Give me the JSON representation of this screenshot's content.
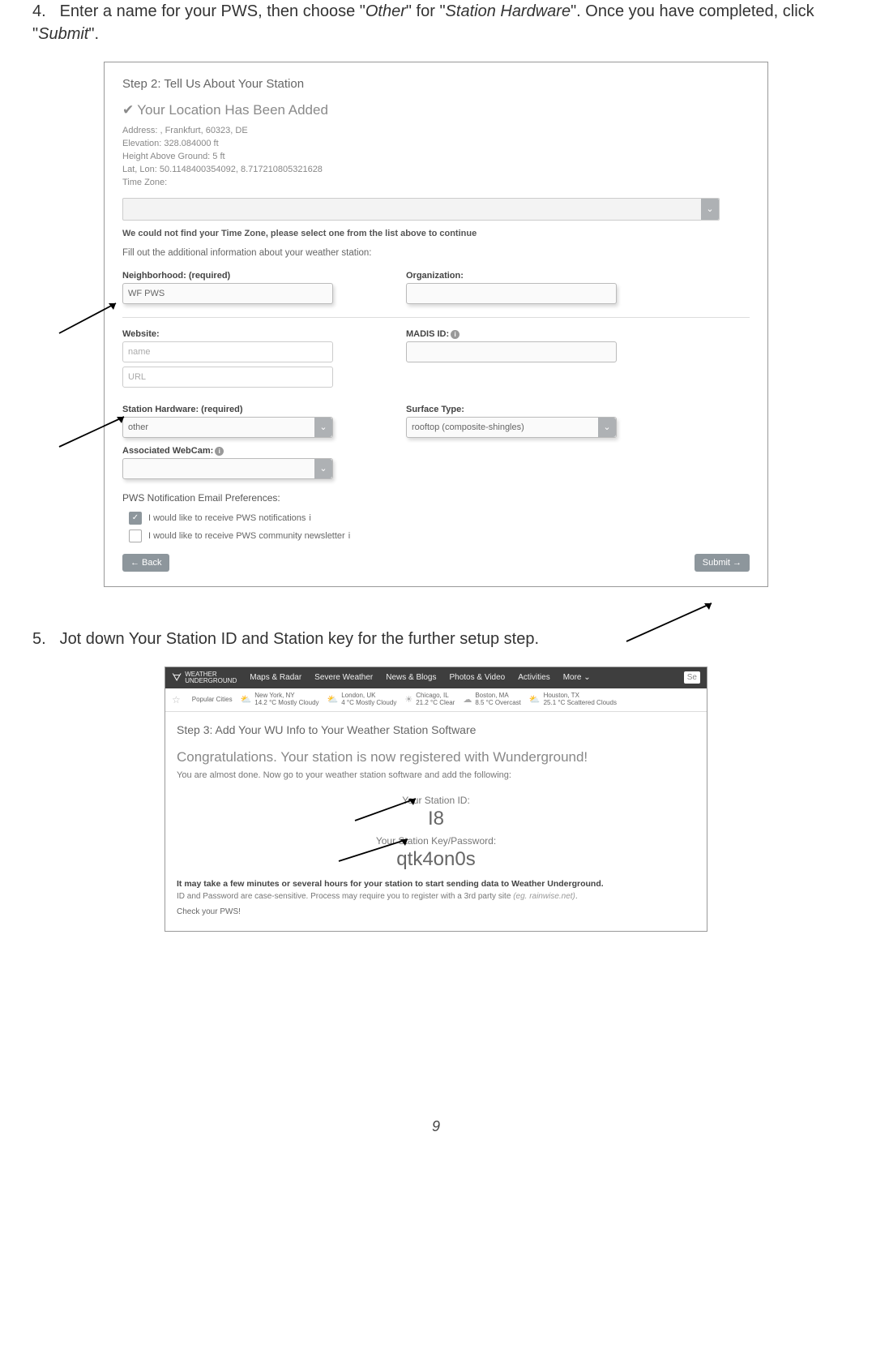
{
  "instr4": {
    "num": "4.",
    "text_a": "Enter a name for your PWS, then choose \"",
    "text_b": "Other",
    "text_c": "\" for \"",
    "text_d": "Station Hardware",
    "text_e": "\". Once you have completed, click \"",
    "text_f": "Submit",
    "text_g": "\"."
  },
  "shot1": {
    "step_title": "Step 2: Tell Us About Your Station",
    "loc_added": "Your Location Has Been Added",
    "info": {
      "address": "Address:   , Frankfurt, 60323, DE",
      "elevation": "Elevation:   328.084000   ft",
      "height": "Height Above Ground:   5   ft",
      "latlon": "Lat, Lon:   50.1148400354092, 8.717210805321628",
      "tz": "Time Zone:"
    },
    "warn": "We could not find your Time Zone, please select one from the list above to continue",
    "fillout": "Fill out the additional information about your weather station:",
    "neighborhood_label": "Neighborhood: (required)",
    "neighborhood_value": "WF PWS",
    "organization_label": "Organization:",
    "website_label": "Website:",
    "website_name_ph": "name",
    "website_url_ph": "URL",
    "madis_label": "MADIS ID:",
    "hardware_label": "Station Hardware: (required)",
    "hardware_value": "other",
    "surface_label": "Surface Type:",
    "surface_value": "rooftop (composite-shingles)",
    "webcam_label": "Associated WebCam:",
    "prefs_title": "PWS Notification Email Preferences:",
    "cb1": "I would like to receive PWS notifications",
    "cb2": "I would like to receive PWS community newsletter",
    "back": "Back",
    "submit": "Submit"
  },
  "instr5": {
    "num": "5.",
    "text": "Jot down Your Station ID and Station key for the further setup step."
  },
  "shot2": {
    "nav": {
      "brand1": "WEATHER",
      "brand2": "UNDERGROUND",
      "i1": "Maps & Radar",
      "i2": "Severe Weather",
      "i3": "News & Blogs",
      "i4": "Photos & Video",
      "i5": "Activities",
      "i6": "More ⌄",
      "search": "Se"
    },
    "cities": {
      "pop": "Popular Cities",
      "c1a": "New York, NY",
      "c1b": "14.2 °C Mostly Cloudy",
      "c2a": "London, UK",
      "c2b": "4 °C Mostly Cloudy",
      "c3a": "Chicago, IL",
      "c3b": "21.2 °C Clear",
      "c4a": "Boston, MA",
      "c4b": "8.5 °C Overcast",
      "c5a": "Houston, TX",
      "c5b": "25.1 °C Scattered Clouds"
    },
    "step3_title": "Step 3: Add Your WU Info to Your Weather Station Software",
    "congrats": "Congratulations. Your station is now registered with Wunderground!",
    "almost": "You are almost done. Now go to your weather station software and add the following:",
    "ysid_label": "Your Station ID:",
    "ysid_value": "I8",
    "ykey_label": "Your Station Key/Password:",
    "ykey_value": "qtk4on0s",
    "maynote": "It may take a few minutes or several hours for your station to start sending data to Weather Underground.",
    "idnote_a": "ID and Password are case-sensitive. Process may require you to register with a 3rd party site ",
    "idnote_b": "(eg. rainwise.net)",
    "idnote_c": ".",
    "checkpws": "Check your PWS!"
  },
  "pagenum": "9"
}
